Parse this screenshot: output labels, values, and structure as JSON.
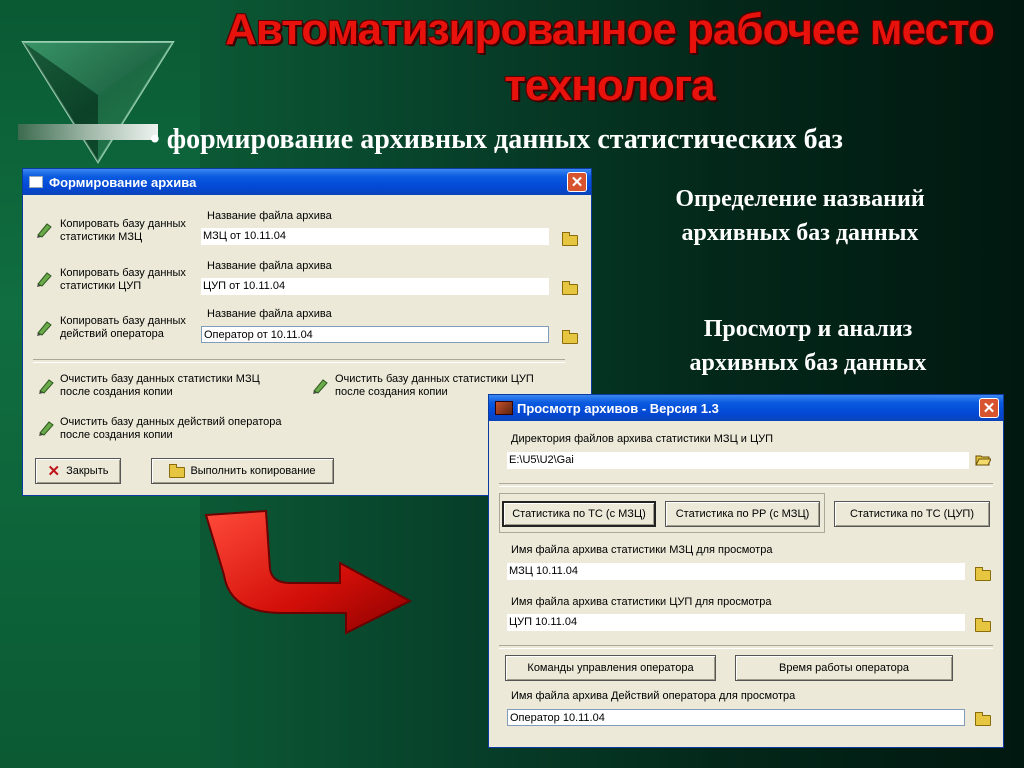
{
  "slide": {
    "title_line1": "Автоматизированное рабочее место",
    "title_line2": "технолога",
    "bullet": "• формирование архивных данных статистических баз",
    "caption_top": [
      "Определение названий",
      "архивных баз данных"
    ],
    "caption_mid": [
      "Просмотр и анализ",
      "архивных баз данных"
    ],
    "accent_red": "#e8120c"
  },
  "archive_window": {
    "title": "Формирование архива",
    "rows": [
      {
        "action_line1": "Копировать базу данных",
        "action_line2": "статистики МЗЦ",
        "field_label": "Название файла архива",
        "field_value": "МЗЦ от 10.11.04"
      },
      {
        "action_line1": "Копировать базу данных",
        "action_line2": "статистики ЦУП",
        "field_label": "Название файла архива",
        "field_value": "ЦУП от 10.11.04"
      },
      {
        "action_line1": "Копировать базу данных",
        "action_line2": "действий оператора",
        "field_label": "Название файла архива",
        "field_value": "Оператор от 10.11.04"
      }
    ],
    "clear_options": [
      {
        "line1": "Очистить базу данных статистики МЗЦ",
        "line2": "после создания копии"
      },
      {
        "line1": "Очистить базу данных статистики ЦУП",
        "line2": "после создания копии"
      },
      {
        "line1": "Очистить базу данных действий оператора",
        "line2": "после создания копии"
      }
    ],
    "close_label": "Закрыть",
    "run_label": "Выполнить копирование"
  },
  "view_window": {
    "title": "Просмотр архивов - Версия 1.3",
    "dir_label": "Директория файлов архива статистики МЗЦ и ЦУП",
    "dir_value": "E:\\U5\\U2\\Gai",
    "stat_buttons": [
      "Статистика по ТС (с МЗЦ)",
      "Статистика по РР (с МЗЦ)",
      "Статистика по ТС (ЦУП)"
    ],
    "mzc_label": "Имя файла архива статистики МЗЦ для просмотра",
    "mzc_value": "МЗЦ 10.11.04",
    "cup_label": "Имя файла архива статистики ЦУП для просмотра",
    "cup_value": "ЦУП 10.11.04",
    "op_buttons": [
      "Команды управления оператора",
      "Время работы оператора"
    ],
    "op_label": "Имя файла архива Действий оператора для просмотра",
    "op_value": "Оператор 10.11.04"
  }
}
